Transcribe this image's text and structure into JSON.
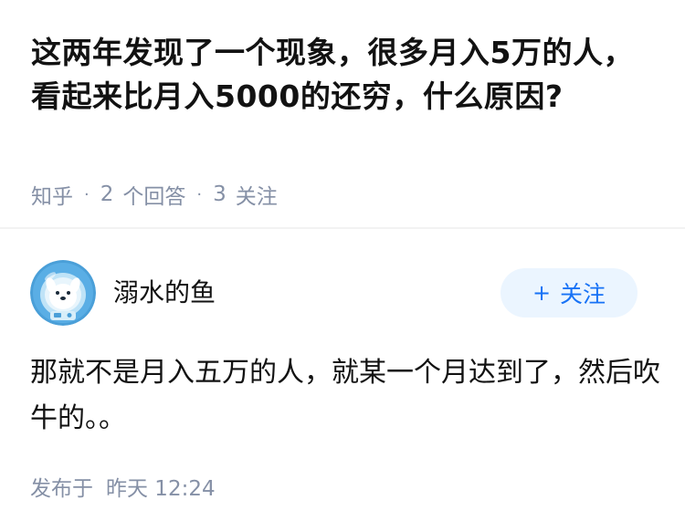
{
  "question": {
    "title": "这两年发现了一个现象，很多月入5万的人，看起来比月入5000的还穷，什么原因?",
    "source": "知乎",
    "answers_count": "2",
    "answers_label": "个回答",
    "followers_count": "3",
    "followers_label": "关注",
    "separator": "·"
  },
  "answer": {
    "author": "溺水的鱼",
    "avatar_icon": "astronaut-dog-avatar",
    "follow_plus": "+",
    "follow_label": "关注",
    "content": "那就不是月入五万的人，就某一个月达到了，然后吹牛的。。",
    "published_label": "发布于",
    "published_time": "昨天 12:24"
  },
  "colors": {
    "meta_text": "#8590a6",
    "follow_bg": "#ebf5ff",
    "follow_text": "#1772f6",
    "avatar_bg": "#4a9fd8"
  }
}
